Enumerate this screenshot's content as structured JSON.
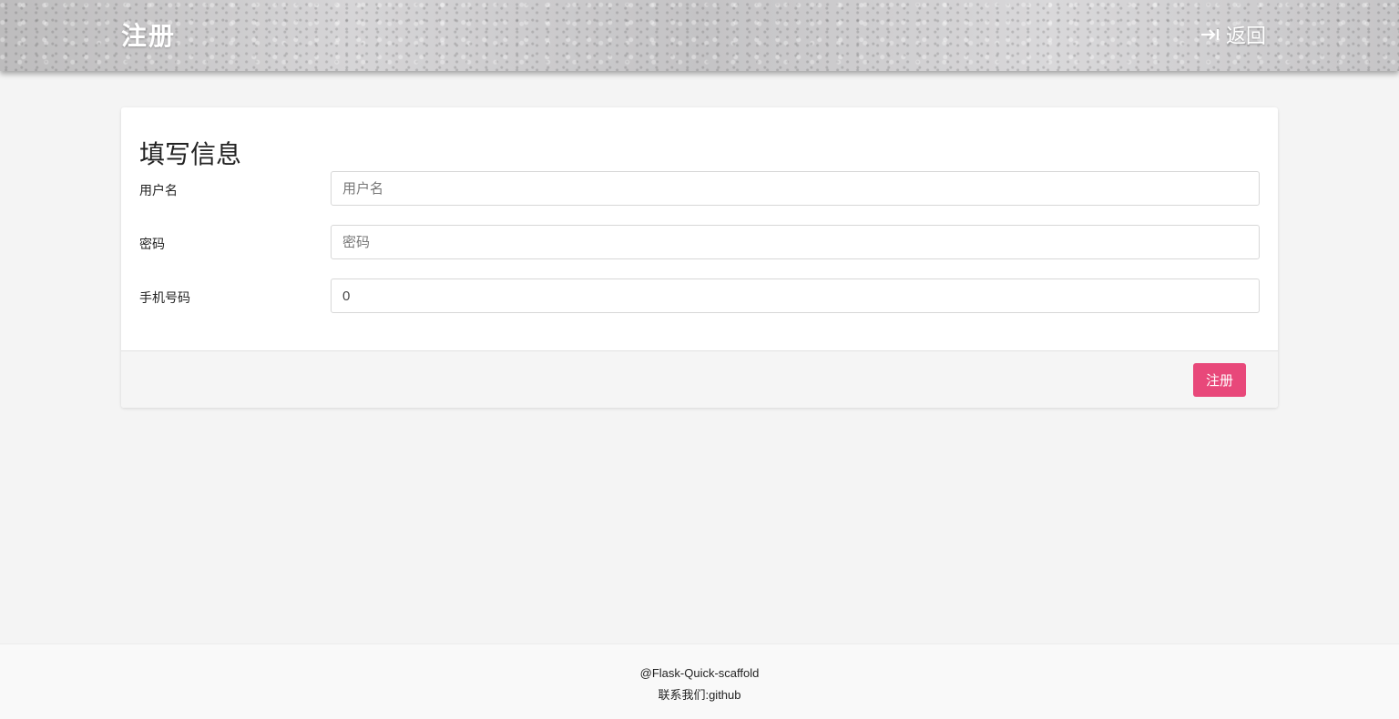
{
  "header": {
    "title": "注册",
    "back_label": "返回",
    "back_icon": "sign-out-arrow-icon"
  },
  "form": {
    "title": "填写信息",
    "fields": [
      {
        "label": "用户名",
        "value": "",
        "placeholder": "用户名"
      },
      {
        "label": "密码",
        "value": "",
        "placeholder": "密码"
      },
      {
        "label": "手机号码",
        "value": "0",
        "placeholder": ""
      }
    ],
    "submit_label": "注册"
  },
  "footer": {
    "line1": "@Flask-Quick-scaffold",
    "line2": "联系我们:github"
  },
  "colors": {
    "accent": "#e8487a",
    "background": "#f4f4f4"
  }
}
